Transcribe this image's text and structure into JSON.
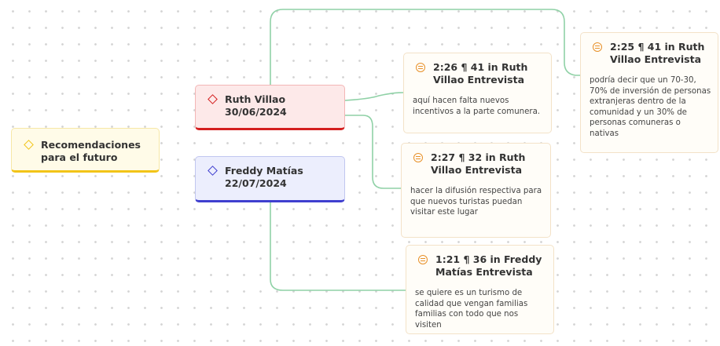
{
  "colors": {
    "connector": "#8fd1a6",
    "topic_accent": "#f2c418",
    "ruth_accent": "#d41f1f",
    "freddy_accent": "#3f3fcf",
    "quote_icon": "#e8912a"
  },
  "topic": {
    "label": "Recomendaciones para el futuro",
    "icon": "diamond-icon"
  },
  "codes": [
    {
      "label": "Ruth Villao 30/06/2024",
      "icon": "diamond-icon"
    },
    {
      "label": "Freddy Matías 22/07/2024",
      "icon": "diamond-icon"
    }
  ],
  "quotes": [
    {
      "icon": "quote-icon",
      "title": "2:25 ¶ 41 in Ruth Villao Entrevista",
      "text": "podría decir que un 70-30, 70% de inversión de personas extranjeras dentro de la comunidad y un 30% de personas comuneras o nativas"
    },
    {
      "icon": "quote-icon",
      "title": "2:26 ¶ 41 in Ruth Villao Entrevista",
      "text": "aquí hacen falta nuevos incentivos a la parte comunera."
    },
    {
      "icon": "quote-icon",
      "title": "2:27 ¶ 32 in Ruth Villao Entrevista",
      "text": "hacer la difusión respectiva para que nuevos turistas puedan visitar este lugar"
    },
    {
      "icon": "quote-icon",
      "title": "1:21 ¶ 36 in Freddy Matías Entrevista",
      "text": "se quiere es un turismo de calidad que vengan familias familias con todo que nos visiten"
    }
  ]
}
